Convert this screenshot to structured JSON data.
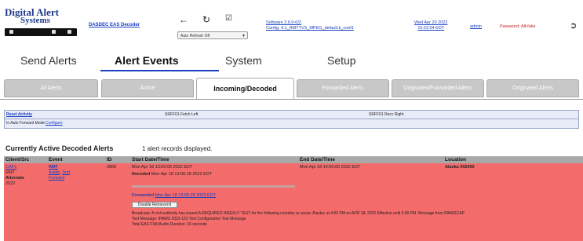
{
  "header": {
    "logo_line1": "Digital Alert",
    "logo_line2": "Systems",
    "model": "DASDEC EAS Decoder",
    "select_value": "Auto Refresh Off",
    "software_line1": "Software 2.6.0-0/2",
    "software_line2": "Config: 4.1_RMTTVS_MPEG_default.k_conf1",
    "datetime_line1": "Wed Apr 20 2022",
    "datetime_line2": "15:22:04 EDT",
    "admin_link": "admin",
    "password_warning": "Password: Alt-fake"
  },
  "main_tabs": [
    "Send Alerts",
    "Alert Events",
    "System",
    "Setup"
  ],
  "sub_tabs": [
    "All Alerts",
    "Active",
    "Incoming/Decoded",
    "Forwarded Alerts",
    "Originated/Forwarded Alerts",
    "Originated Alerts"
  ],
  "filter": {
    "reset_link": "Reset Activity",
    "left_value": "SRFF01 Fetch Left",
    "right_value": "SRFF01 Recv Right",
    "row2_label": "In Auto Forward Mode",
    "row2_link": "Configure"
  },
  "section": {
    "title": "Currently Active Decoded Alerts",
    "count": "1 alert records displayed."
  },
  "table": {
    "headers": [
      "Client/Src",
      "Event",
      "ID",
      "Start Date/Time",
      "End Date/Time",
      "Location"
    ],
    "row": {
      "client_link": "CAP1",
      "client_sub1": "RMT",
      "client_sub2": "Alternate",
      "client_sub3": "2022",
      "event_code": "RMT",
      "event_links1": "Audio",
      "event_links2": "Text",
      "event_links3": "Forward",
      "id": "2805",
      "start_time": "Mon Apr 18 13:00:00 2022 EDT",
      "decoded_label": "Decoded",
      "decoded_time": "Mon Apr 18 13:00:18 2022 EDT",
      "forwarded_label": "Forwarded",
      "forwarded_time": "Mon Apr 18 13:00:28 2022 EDT",
      "response_button": "Disable Retransmit",
      "end_time": "Mon Apr 18 14:00:00 2022 EDT",
      "location": "Alaska 002000",
      "message_line1": "Broadcast: A civil authority has issued A REQUIRED WEEKLY TEST for the following counties or areas: Alaska; at 4:00 PM on APR 18, 2022 Effective until 5:00 PM. Message from IPAWSCAP.",
      "message_line2": "Text Message: IPAWS 2022-123 Test Configuration Test Message",
      "message_line3": "Total EAS FSK/Audio Duration: 16 seconds"
    }
  }
}
